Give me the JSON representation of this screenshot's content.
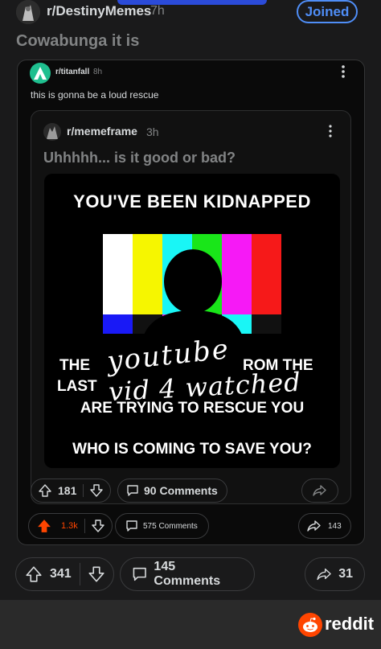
{
  "outer": {
    "subreddit": "r/DestinyMemes",
    "age": "7h",
    "join_label": "Joined",
    "title": "Cowabunga it is",
    "upvotes": "341",
    "comments": "145 Comments",
    "shares": "31"
  },
  "middle": {
    "subreddit": "r/titanfall",
    "age": "8h",
    "title": "this is gonna be a loud rescue",
    "upvotes": "1.3k",
    "comments": "575 Comments",
    "shares": "143"
  },
  "inner": {
    "subreddit": "r/memeframe",
    "age": "3h",
    "title": "Uhhhhh... is it good or bad?",
    "upvotes": "181",
    "comments": "90 Comments"
  },
  "meme": {
    "heading": "YOU'VE BEEN KIDNAPPED",
    "line1_left": "THE",
    "line1_right": "ROM THE",
    "line2_left": "LAST",
    "line3": "ARE TRYING TO RESCUE YOU",
    "line4": "WHO IS COMING TO SAVE YOU?",
    "scribble1": "youtube",
    "scribble2": "vid 4 watched",
    "bars": [
      "#ffffff",
      "#f6f600",
      "#19f6f6",
      "#19e619",
      "#f619f6",
      "#f61919"
    ]
  },
  "footer": {
    "brand": "reddit"
  },
  "colors": {
    "join": "#4f8ef7",
    "upvote_active": "#ff4500",
    "titanfall_icon": "#1fbf8f"
  }
}
